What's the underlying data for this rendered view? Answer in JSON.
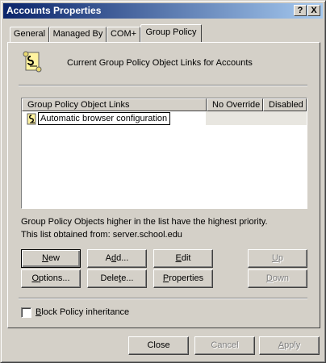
{
  "window": {
    "title": "Accounts Properties",
    "help_label": "?",
    "close_label": "X"
  },
  "tabs": [
    {
      "label": "General",
      "active": false
    },
    {
      "label": "Managed By",
      "active": false
    },
    {
      "label": "COM+",
      "active": false
    },
    {
      "label": "Group Policy",
      "active": true
    }
  ],
  "group_policy": {
    "heading": "Current Group Policy Object Links for Accounts",
    "list": {
      "columns": [
        "Group Policy Object Links",
        "No Override",
        "Disabled"
      ],
      "rows": [
        {
          "name": "Automatic browser configuration",
          "no_override": "",
          "disabled": "",
          "editing": true
        }
      ]
    },
    "info_line1": "Group Policy Objects higher in the list have the highest priority.",
    "info_line2": "This list obtained from: server.school.edu",
    "buttons": {
      "new": {
        "pre": "",
        "acc": "N",
        "post": "ew"
      },
      "add": {
        "pre": "A",
        "acc": "d",
        "post": "d..."
      },
      "edit": {
        "pre": "",
        "acc": "E",
        "post": "dit"
      },
      "up": {
        "pre": "",
        "acc": "U",
        "post": "p"
      },
      "options": {
        "pre": "",
        "acc": "O",
        "post": "ptions..."
      },
      "delete": {
        "pre": "Dele",
        "acc": "t",
        "post": "e..."
      },
      "properties": {
        "pre": "",
        "acc": "P",
        "post": "roperties"
      },
      "down": {
        "pre": "",
        "acc": "D",
        "post": "own"
      }
    },
    "block_inheritance": {
      "pre": "",
      "acc": "B",
      "post": "lock Policy inheritance",
      "checked": false
    }
  },
  "footer": {
    "close": "Close",
    "cancel": "Cancel",
    "apply": {
      "pre": "",
      "acc": "A",
      "post": "pply"
    }
  },
  "icons": {
    "policy": "gpo-scroll-icon"
  }
}
